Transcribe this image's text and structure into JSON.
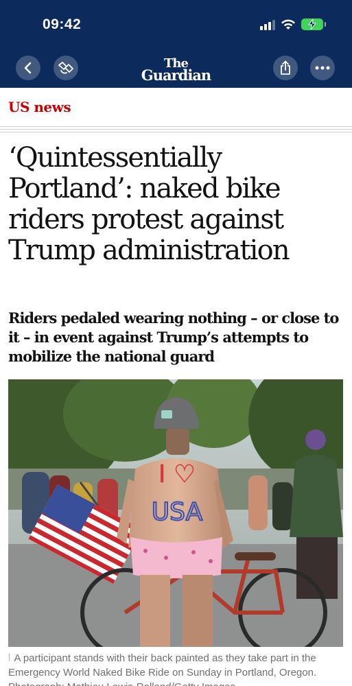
{
  "status_bar": {
    "time": "09:42"
  },
  "header": {
    "logo_line1": "The",
    "logo_line2": "Guardian",
    "icons": [
      "back-icon",
      "glasses-icon",
      "share-icon",
      "more-icon"
    ]
  },
  "article": {
    "section": "US news",
    "headline": "‘Quintessentially Portland’: naked bike riders protest against Trump administration",
    "standfirst": "Riders pedaled wearing nothing – or close to it – in event against Trump’s attempts to mobilize the national guard",
    "body_text": {
      "line1": "I ♡",
      "line2": "USA"
    },
    "caption": "A participant stands with their back painted as they take part in the Emergency World Naked Bike Ride on Sunday in Portland, Oregon. Photograph: Mathieu Lewis-Rolland/Getty Images",
    "caption_mark": "⦚"
  },
  "colors": {
    "header_bg": "#0c2a5b",
    "section": "#c70000",
    "battery": "#41d35a"
  }
}
